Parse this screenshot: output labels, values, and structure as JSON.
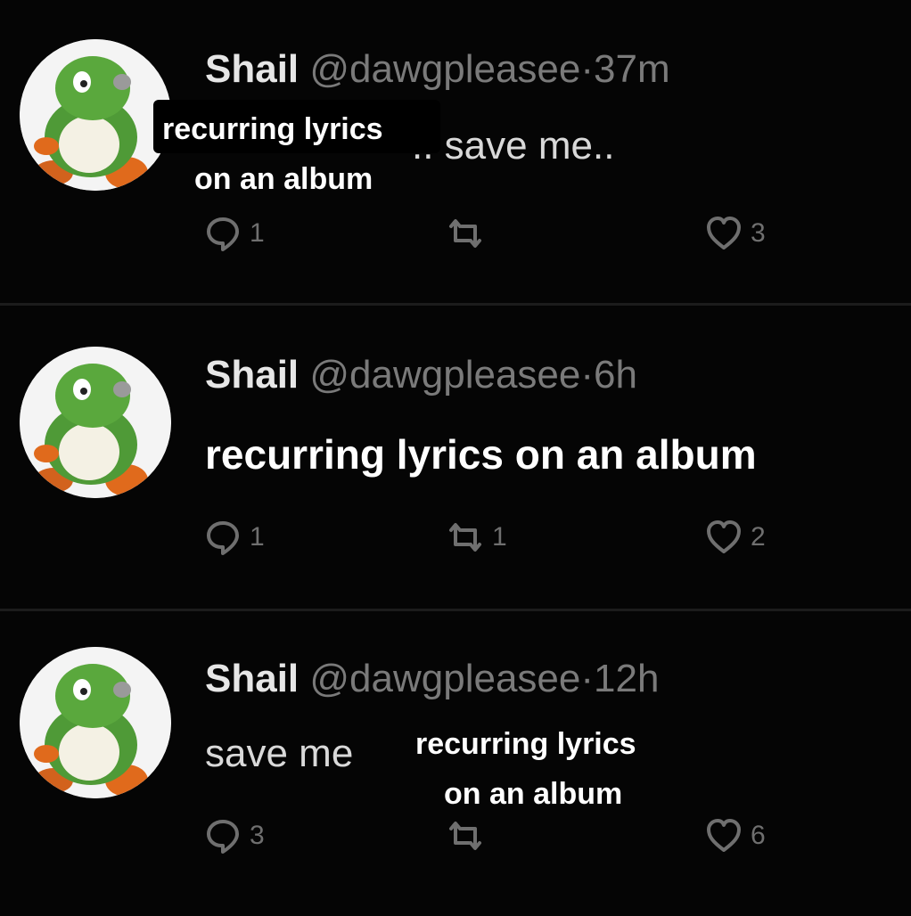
{
  "tweets": [
    {
      "name": "Shail",
      "handle": "@dawgpleasee",
      "separator": "·",
      "time": "37m",
      "text": ".. save me..",
      "replies": "1",
      "retweets": "",
      "likes": "3",
      "overlay": [
        "recurring lyrics",
        "on an album"
      ]
    },
    {
      "name": "Shail",
      "handle": "@dawgpleasee",
      "separator": "·",
      "time": "6h",
      "text": "recurring lyrics on an album",
      "replies": "1",
      "retweets": "1",
      "likes": "2"
    },
    {
      "name": "Shail",
      "handle": "@dawgpleasee",
      "separator": "·",
      "time": "12h",
      "text": "save me",
      "replies": "3",
      "retweets": "",
      "likes": "6",
      "overlay": [
        "recurring lyrics",
        "on an album"
      ]
    }
  ],
  "icons": {
    "avatar": "yoshi-avatar-icon",
    "reply": "reply-bubble-icon",
    "retweet": "retweet-icon",
    "like": "heart-icon"
  },
  "colors": {
    "background": "#050505",
    "name": "#e6e6e6",
    "muted": "#7a7a7a",
    "caption": "#ffffff"
  }
}
